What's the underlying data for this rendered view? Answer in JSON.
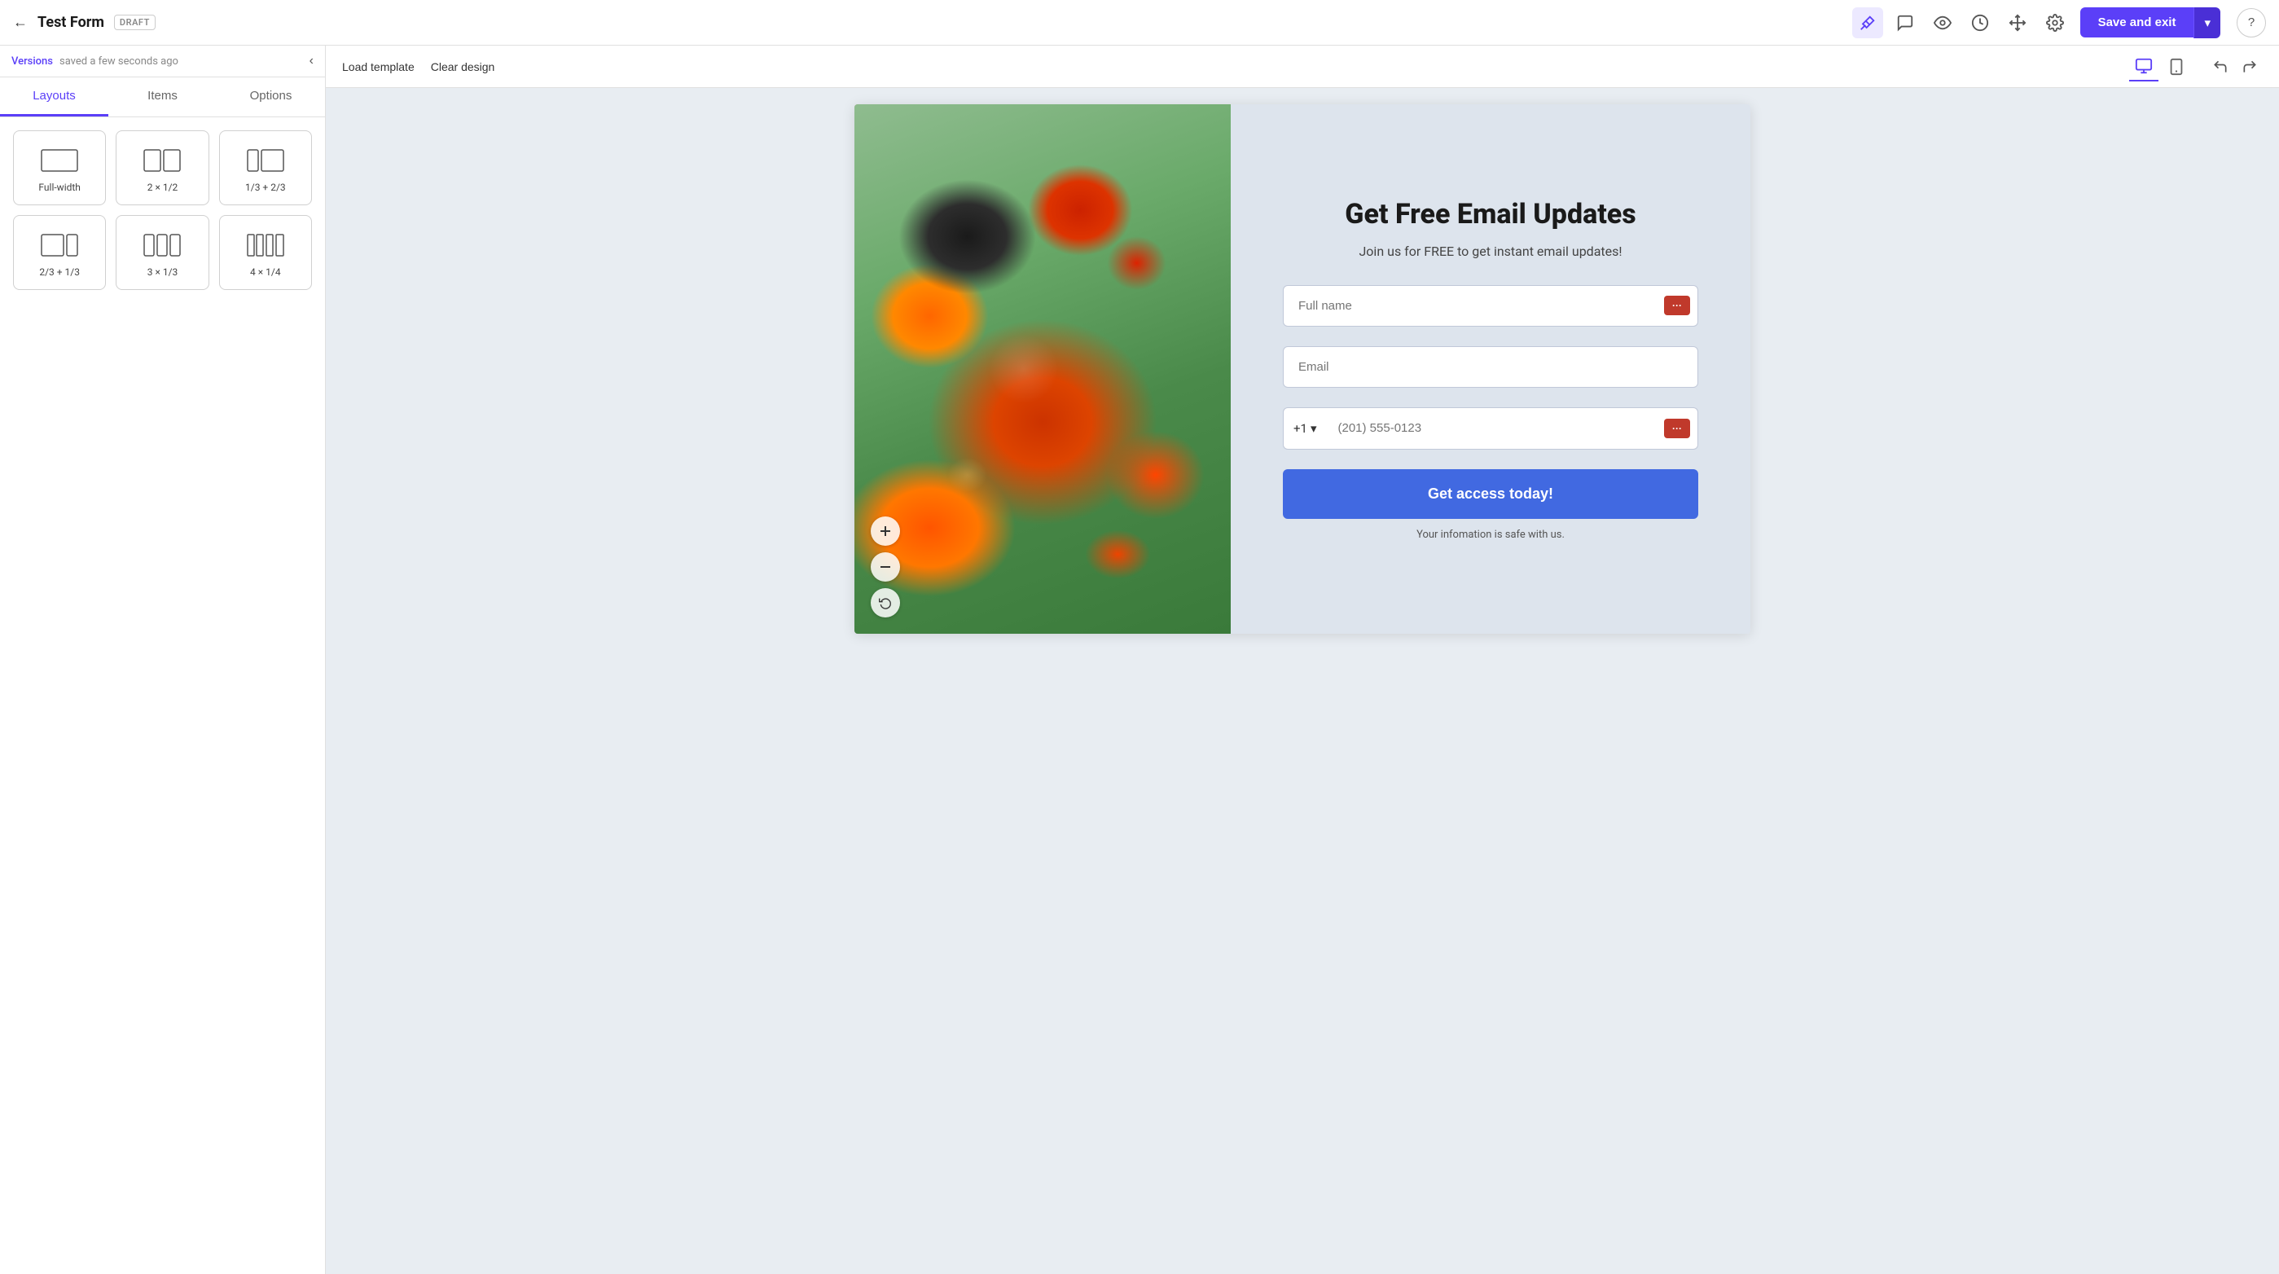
{
  "header": {
    "back_icon": "←",
    "title": "Test Form",
    "draft_label": "DRAFT",
    "icons": [
      {
        "name": "magic-wand-icon",
        "symbol": "✦",
        "active": true
      },
      {
        "name": "chat-icon",
        "symbol": "💬",
        "active": false
      },
      {
        "name": "eye-icon",
        "symbol": "👁",
        "active": false
      },
      {
        "name": "history-icon",
        "symbol": "🕐",
        "active": false
      },
      {
        "name": "move-icon",
        "symbol": "✛",
        "active": false
      },
      {
        "name": "settings-icon",
        "symbol": "⚙",
        "active": false
      }
    ],
    "save_exit_label": "Save and exit",
    "dropdown_icon": "▾",
    "help_icon": "?"
  },
  "left_panel": {
    "versions_link": "Versions",
    "versions_text": "saved a few seconds ago",
    "collapse_icon": "‹",
    "tabs": [
      {
        "id": "layouts",
        "label": "Layouts",
        "active": true
      },
      {
        "id": "items",
        "label": "Items",
        "active": false
      },
      {
        "id": "options",
        "label": "Options",
        "active": false
      }
    ],
    "layouts": [
      {
        "id": "full-width",
        "label": "Full-width",
        "cols": 1
      },
      {
        "id": "2x1-2",
        "label": "2 × 1/2",
        "cols": 2
      },
      {
        "id": "1-3-2-3",
        "label": "1/3 + 2/3",
        "cols": "1-3-2-3"
      },
      {
        "id": "2-3-1-3",
        "label": "2/3 + 1/3",
        "cols": "2-3-1-3"
      },
      {
        "id": "3x1-3",
        "label": "3 × 1/3",
        "cols": 3
      },
      {
        "id": "4x1-4",
        "label": "4 × 1/4",
        "cols": 4
      }
    ]
  },
  "canvas_toolbar": {
    "load_template_label": "Load template",
    "clear_design_label": "Clear design",
    "view_desktop_icon": "🖥",
    "view_mobile_icon": "📱",
    "undo_icon": "↩",
    "redo_icon": "↪"
  },
  "form_preview": {
    "heading": "Get Free Email Updates",
    "subtext": "Join us for FREE to get instant email updates!",
    "full_name_placeholder": "Full name",
    "email_placeholder": "Email",
    "phone_prefix": "+1",
    "phone_placeholder": "(201) 555-0123",
    "submit_label": "Get access today!",
    "privacy_text": "Your infomation is safe with us.",
    "options_icon": "···"
  }
}
